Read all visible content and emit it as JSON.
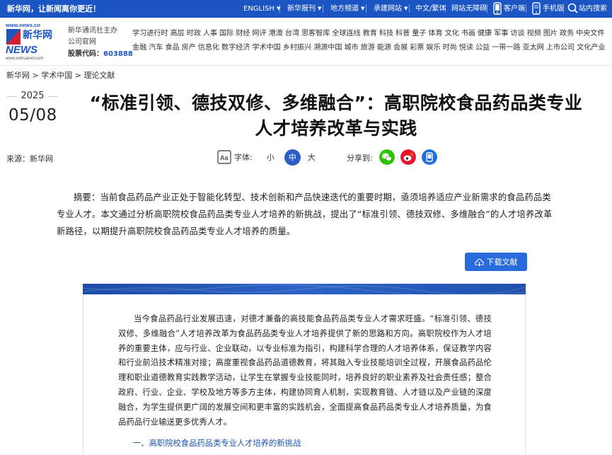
{
  "topbar": {
    "slogan": "新华网，让新闻离你更近！",
    "english": "ENGLISH",
    "newspaper": "新华报刊",
    "channels": "地方频道",
    "portal": "承建网站",
    "lang": "中文/繁体",
    "accessibility": "网站无障碍",
    "client": "客户端",
    "mobile": "手机版",
    "search": "站内搜索"
  },
  "header": {
    "logo_top": "www.news.cn",
    "logo_name": "新华网",
    "logo_en": "NEWS",
    "logo_url": "www.xinhuanet.com",
    "org_line": "新华通讯社主办公司官网",
    "stock_label": "股票代码：",
    "stock_code": "603888",
    "nav_row1": [
      "学习进行时",
      "高层",
      "时政",
      "人事",
      "国际",
      "财经",
      "网评",
      "港澳",
      "台湾",
      "思客智库",
      "全球连线",
      "教育",
      "科技",
      "科普",
      "量子",
      "体育",
      "文化",
      "书画",
      "健康",
      "军事",
      "访谈",
      "视频",
      "图片",
      "政务",
      "中央文件"
    ],
    "nav_row2": [
      "金融",
      "汽车",
      "食品",
      "房产",
      "信息化",
      "数字经济",
      "学术中国",
      "乡村振兴",
      "溯源中国",
      "城市",
      "旅游",
      "能源",
      "会展",
      "彩票",
      "娱乐",
      "时尚",
      "悦读",
      "公益",
      "一带一路",
      "亚太网",
      "上市公司",
      "文化产业"
    ]
  },
  "breadcrumb": {
    "home": "新华网",
    "sep": " > ",
    "level1": "学术中国",
    "level2": "理论文献"
  },
  "article": {
    "year": "2025",
    "month_day": "05/08",
    "title": "“标准引领、德技双修、多维融合”：高职院校食品药品类专业人才培养改革与实践",
    "source": "来源：新华网",
    "font_label": "字体:",
    "font_small": "小",
    "font_medium": "中",
    "font_large": "大",
    "share_label": "分享到:",
    "abstract": "摘要：当前食品药品产业正处于智能化转型、技术创新和产品快速迭代的重要时期，亟须培养适应产业新需求的食品药品类专业人才。本文通过分析高职院校食品药品类专业人才培养的新挑战，提出了“标准引领、德技双修、多维融合”的人才培养改革新路径，以期提升高职院校食品药品类专业人才培养的质量。",
    "download_label": "下载文献",
    "body_paragraph": "当今食品药品行业发展迅速，对德才兼备的高技能食品药品类专业人才需求旺盛。“标准引领、德技双修、多维融合”人才培养改革为食品药品类专业人才培养提供了新的思路和方向。高职院校作为人才培养的重要主体，应与行业、企业联动，以专业标准为指引，构建科学合理的人才培养体系，保证教学内容和行业前沿技术精准对接；高度重视食品药品道德教育，将其融入专业技能培训全过程，开展食品药品伦理和职业道德教育实践教学活动，让学生在掌握专业技能同时，培养良好的职业素养及社会责任感；整合政府、行业、企业、学校及地方等多方主体，构建协同育人机制，实现教育链、人才链以及产业链的深度融合，为学生提供更广阔的发展空间和更丰富的实践机会，全面提高食品药品类专业人才培养质量，为食品药品行业输送更多优秀人才。",
    "section_title": "一、高职院校食品药品类专业人才培养的新挑战"
  },
  "colors": {
    "brand_blue": "#1b55c4",
    "button_blue": "#2a6bdc",
    "wechat": "#2dc100",
    "weibo": "#e6162d",
    "mobile": "#1e6fd9"
  }
}
